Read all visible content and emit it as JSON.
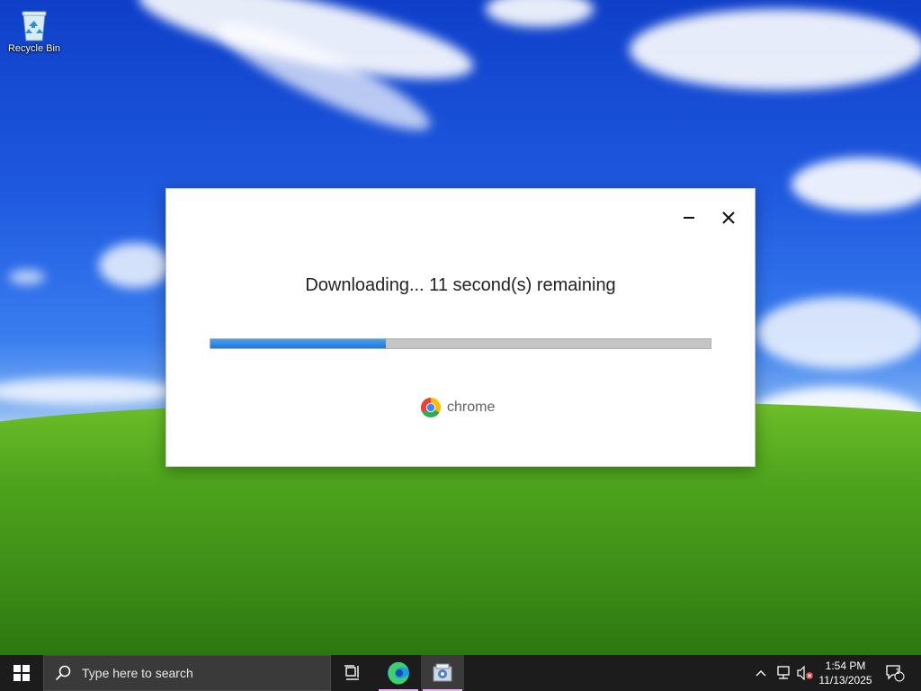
{
  "desktop": {
    "recycle_bin_label": "Recycle Bin"
  },
  "dialog": {
    "status": "Downloading... 11 second(s) remaining",
    "progress_fraction": 0.35,
    "brand_name": "chrome",
    "colors": {
      "progress_fill": "#1f78d8",
      "progress_track": "#c4c4c4"
    }
  },
  "taskbar": {
    "search_placeholder": "Type here to search",
    "clock_time": "1:54 PM",
    "clock_date": "11/13/2025",
    "notification_count": "1",
    "icons": [
      "windows-start-icon",
      "search-icon",
      "task-view-icon",
      "edge-icon",
      "installer-icon",
      "chevron-up-icon",
      "network-icon",
      "volume-muted-icon",
      "notification-icon"
    ]
  }
}
